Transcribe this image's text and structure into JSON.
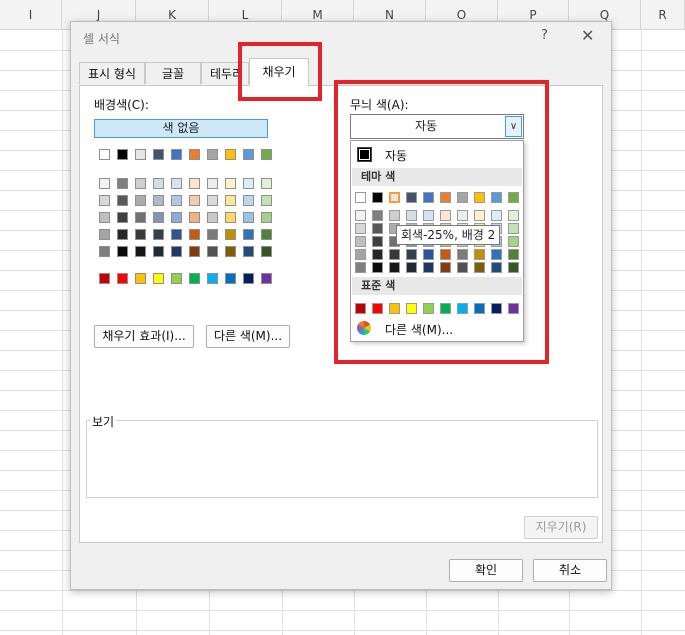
{
  "sheet": {
    "columns": [
      "I",
      "J",
      "K",
      "L",
      "M",
      "N",
      "O",
      "P",
      "Q",
      "R"
    ]
  },
  "dialog": {
    "title": "셀 서식",
    "help": "?",
    "close": "✕",
    "tabs": [
      "표시 형식",
      "글꼴",
      "테두리",
      "채우기"
    ],
    "active_tab": "채우기",
    "background_color_label": "배경색(C):",
    "no_color_label": "색 없음",
    "fill_effects_button": "채우기 효과(I)...",
    "more_colors_button": "다른 색(M)...",
    "pattern_color_label": "무늬 색(A):",
    "pattern_color_value": "자동",
    "preview_label": "보기",
    "clear_button": "지우기(R)",
    "ok_button": "확인",
    "cancel_button": "취소"
  },
  "popup": {
    "automatic_label": "자동",
    "theme_colors_label": "테마 색",
    "standard_colors_label": "표준 색",
    "more_colors_label": "다른 색(M)...",
    "tooltip": "회색-25%, 배경 2"
  },
  "palette": {
    "theme_top": [
      "#ffffff",
      "#000000",
      "#e7e6e6",
      "#44546a",
      "#4472c4",
      "#ed7d31",
      "#a5a5a5",
      "#ffc000",
      "#5b9bd5",
      "#70ad47"
    ],
    "theme_shades": [
      [
        "#f2f2f2",
        "#7f7f7f",
        "#d0cece",
        "#d6dce4",
        "#d9e2f3",
        "#fbe5d5",
        "#ededed",
        "#fff2cc",
        "#ddebf7",
        "#e2efd9"
      ],
      [
        "#d8d8d8",
        "#595959",
        "#aeabab",
        "#adb9ca",
        "#b4c6e7",
        "#f7cbac",
        "#dbdbdb",
        "#fee599",
        "#bdd7ee",
        "#c5e0b3"
      ],
      [
        "#bfbfbf",
        "#3f3f3f",
        "#757070",
        "#8496b0",
        "#8eaadb",
        "#f4b183",
        "#c9c9c9",
        "#ffd965",
        "#9cc3e5",
        "#a8d08d"
      ],
      [
        "#a5a5a5",
        "#262626",
        "#3a3838",
        "#323f4f",
        "#2f5496",
        "#c55a11",
        "#7b7b7b",
        "#bf9000",
        "#2e75b5",
        "#538135"
      ],
      [
        "#7f7f7f",
        "#0c0c0c",
        "#171616",
        "#222a35",
        "#1f3864",
        "#833c0b",
        "#525252",
        "#7f6000",
        "#1e4e79",
        "#375623"
      ]
    ],
    "standard": [
      "#c00000",
      "#ff0000",
      "#ffc000",
      "#ffff00",
      "#92d050",
      "#00b050",
      "#00b0f0",
      "#0070c0",
      "#002060",
      "#7030a0"
    ]
  },
  "highlight_color": "#e0252b"
}
